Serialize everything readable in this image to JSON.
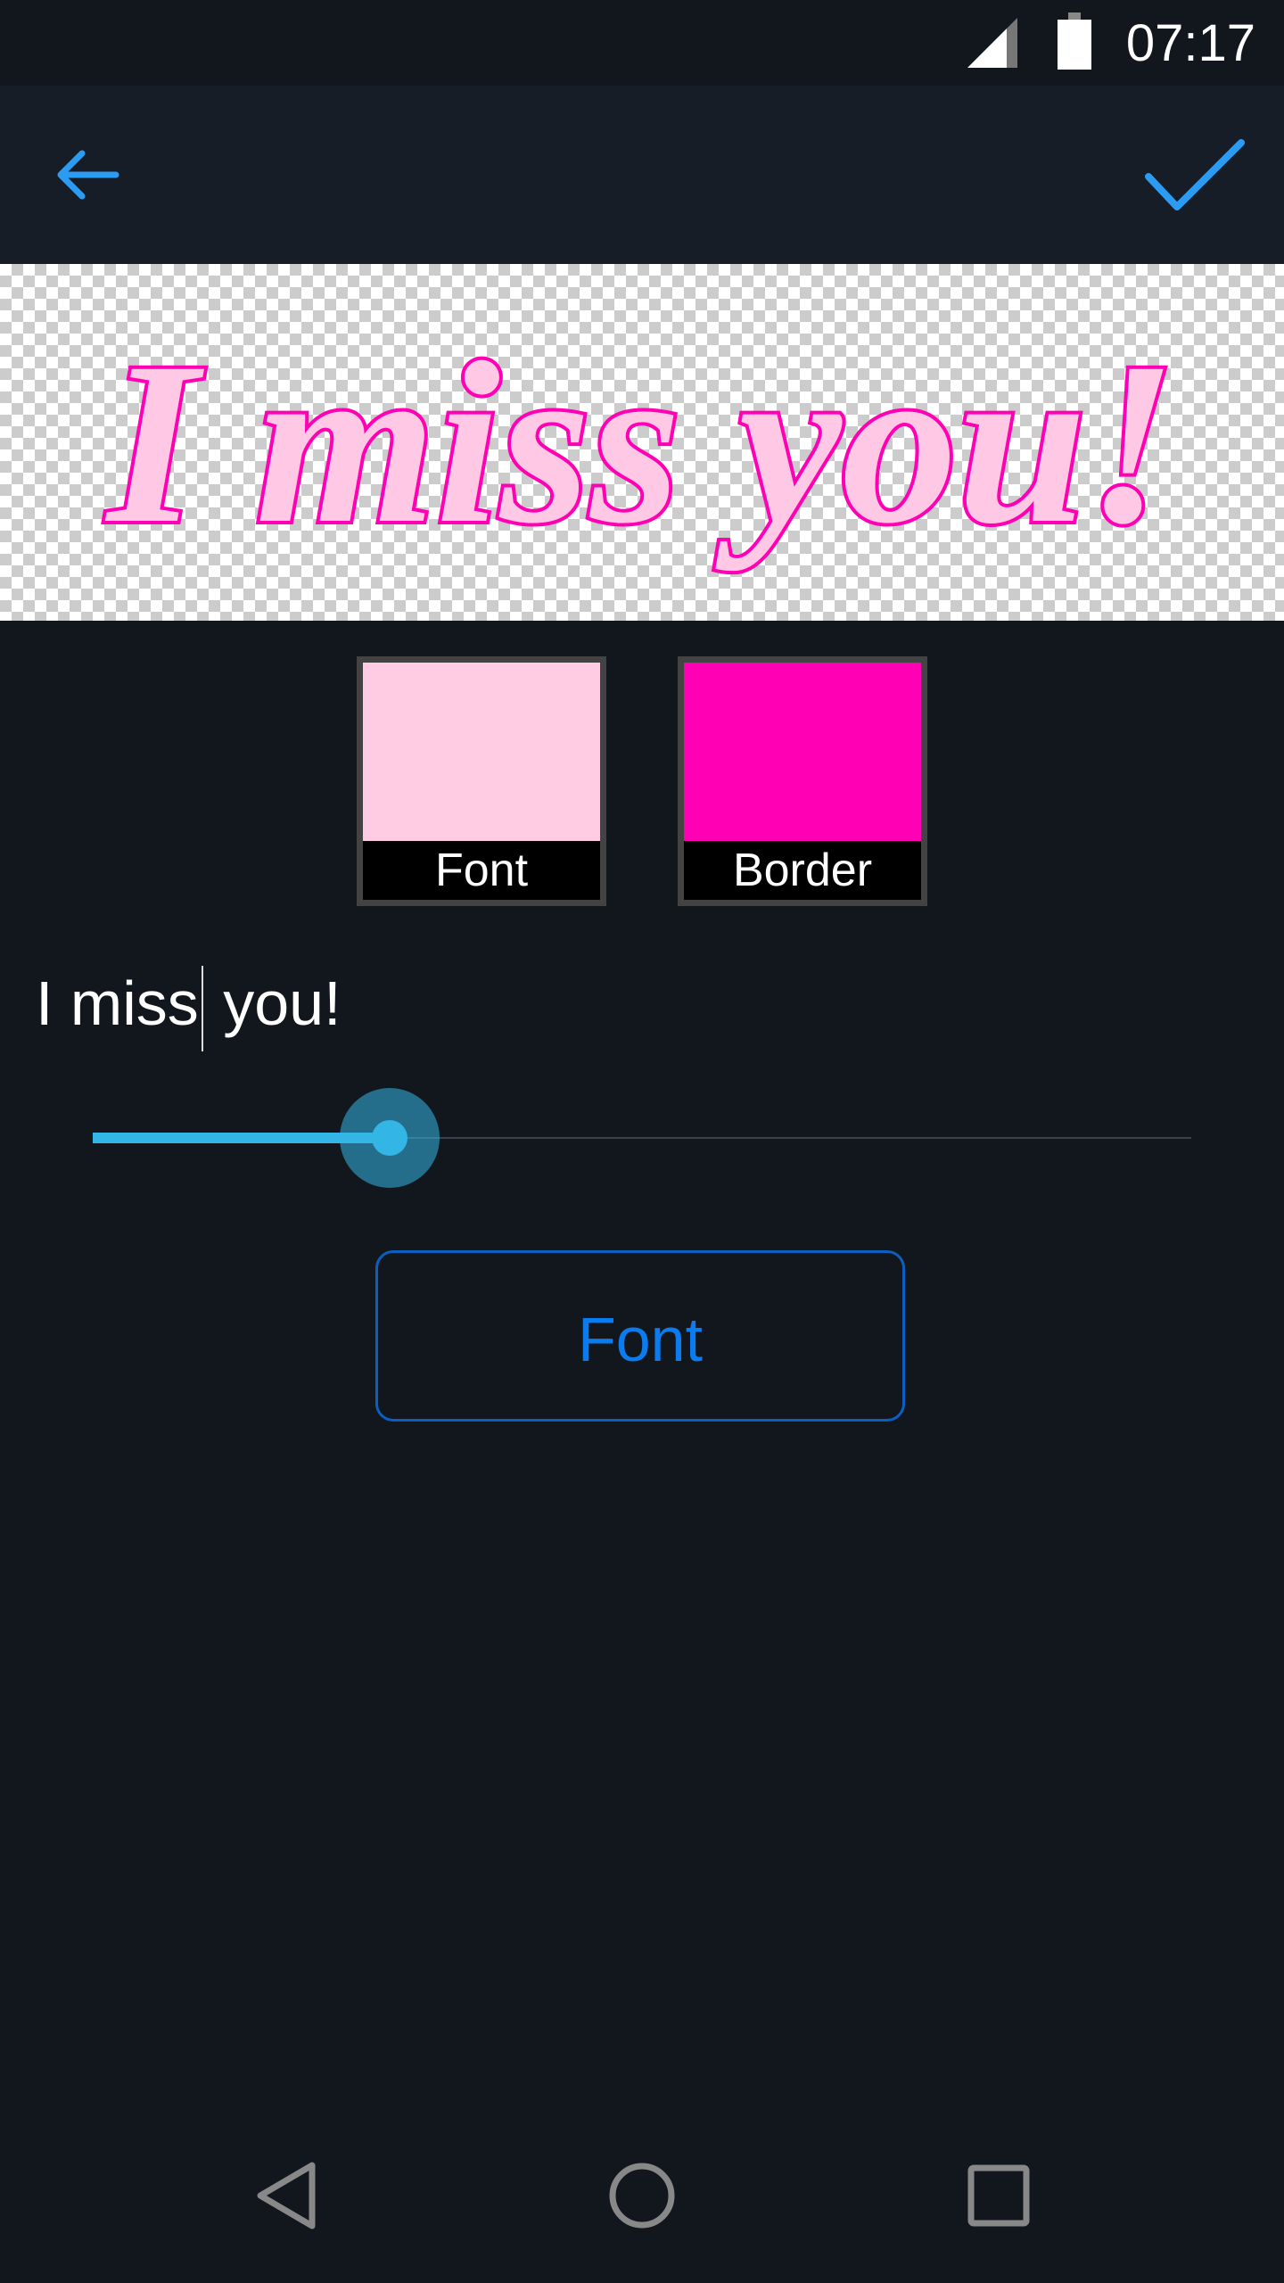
{
  "status_bar": {
    "time": "07:17",
    "icons": [
      "signal-icon",
      "battery-icon"
    ]
  },
  "toolbar": {
    "back_icon": "arrow-left-icon",
    "confirm_icon": "checkmark-icon",
    "accent_color": "#2b9cf2"
  },
  "preview": {
    "text": "I miss you!",
    "fill_color": "#ffc8e4",
    "border_color": "#ff00b4"
  },
  "swatches": [
    {
      "label": "Font",
      "color": "#ffcce4"
    },
    {
      "label": "Border",
      "color": "#ff00b4"
    }
  ],
  "text_input": {
    "value_before_caret": "I miss",
    "value_after_caret": " you!"
  },
  "slider": {
    "value_fraction": 0.27,
    "color": "#33b5e5"
  },
  "font_button": {
    "label": "Font"
  },
  "nav_bar": {
    "icons": [
      "back-triangle-icon",
      "home-circle-icon",
      "recents-square-icon"
    ]
  }
}
